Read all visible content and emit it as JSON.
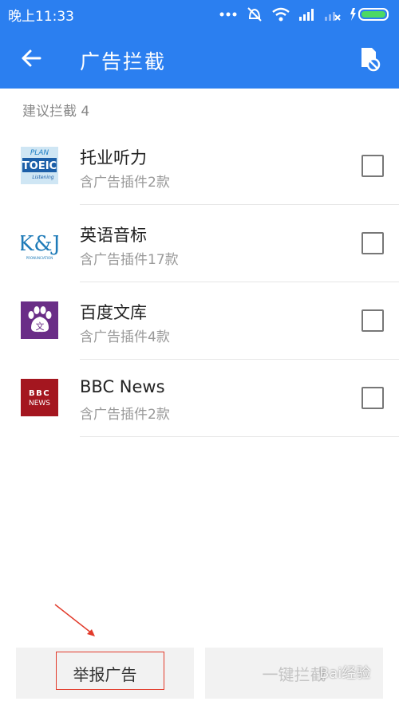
{
  "status": {
    "time": "晚上11:33"
  },
  "header": {
    "title": "广告拦截"
  },
  "section": {
    "label": "建议拦截 4"
  },
  "apps": [
    {
      "name": "托业听力",
      "sub": "含广告插件2款",
      "logo_icon": "toeic-app-icon"
    },
    {
      "name": "英语音标",
      "sub": "含广告插件17款",
      "logo_icon": "kj-pronunciation-app-icon"
    },
    {
      "name": "百度文库",
      "sub": "含广告插件4款",
      "logo_icon": "baidu-wenku-app-icon"
    },
    {
      "name": "BBC News",
      "sub": "含广告插件2款",
      "logo_icon": "bbc-news-app-icon"
    }
  ],
  "logo_text": {
    "toeic_top": "PLAN",
    "toeic_mid": "TOEIC",
    "toeic_bot": "Listening",
    "kj_main": "K&J",
    "kj_sub": "PRONUNCIATION",
    "wenku": "文",
    "bbc": "BBC",
    "news": "NEWS"
  },
  "buttons": {
    "report": "举报广告",
    "block_all": "一键拦截"
  },
  "watermark": "Bai经验",
  "colors": {
    "primary": "#2b7ff0",
    "annotation": "#e23b2b"
  }
}
